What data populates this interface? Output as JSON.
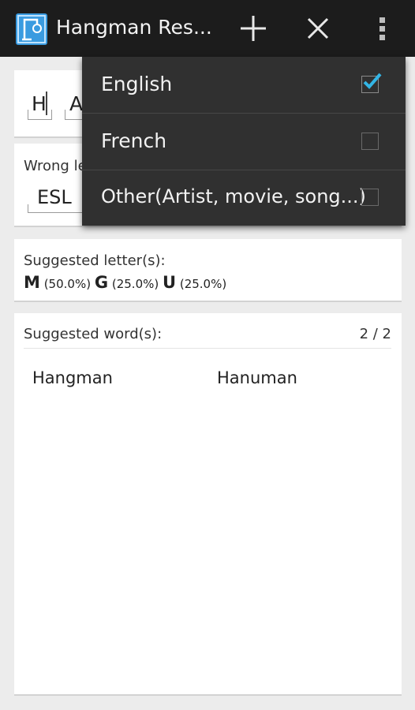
{
  "app": {
    "title": "Hangman Res..."
  },
  "word_input": {
    "letters": [
      "H",
      "A"
    ]
  },
  "wrong_letters": {
    "label": "Wrong le",
    "value": "ESL"
  },
  "suggested_letters": {
    "label": "Suggested letter(s):",
    "items": [
      {
        "letter": "M",
        "pct": "(50.0%)"
      },
      {
        "letter": "G",
        "pct": "(25.0%)"
      },
      {
        "letter": "U",
        "pct": "(25.0%)"
      }
    ]
  },
  "suggested_words": {
    "label": "Suggested word(s):",
    "page": "2 / 2",
    "words": [
      "Hangman",
      "Hanuman"
    ]
  },
  "language_menu": {
    "items": [
      {
        "label": "English",
        "checked": true
      },
      {
        "label": "French",
        "checked": false
      },
      {
        "label": "Other(Artist, movie, song...)",
        "checked": false
      }
    ]
  },
  "colors": {
    "accent": "#33b5e5",
    "actionbar": "#1c1c1c",
    "menu": "#303030"
  },
  "icons": [
    "app-logo-icon",
    "plus-icon",
    "close-icon",
    "overflow-menu-icon",
    "checkmark-icon"
  ]
}
